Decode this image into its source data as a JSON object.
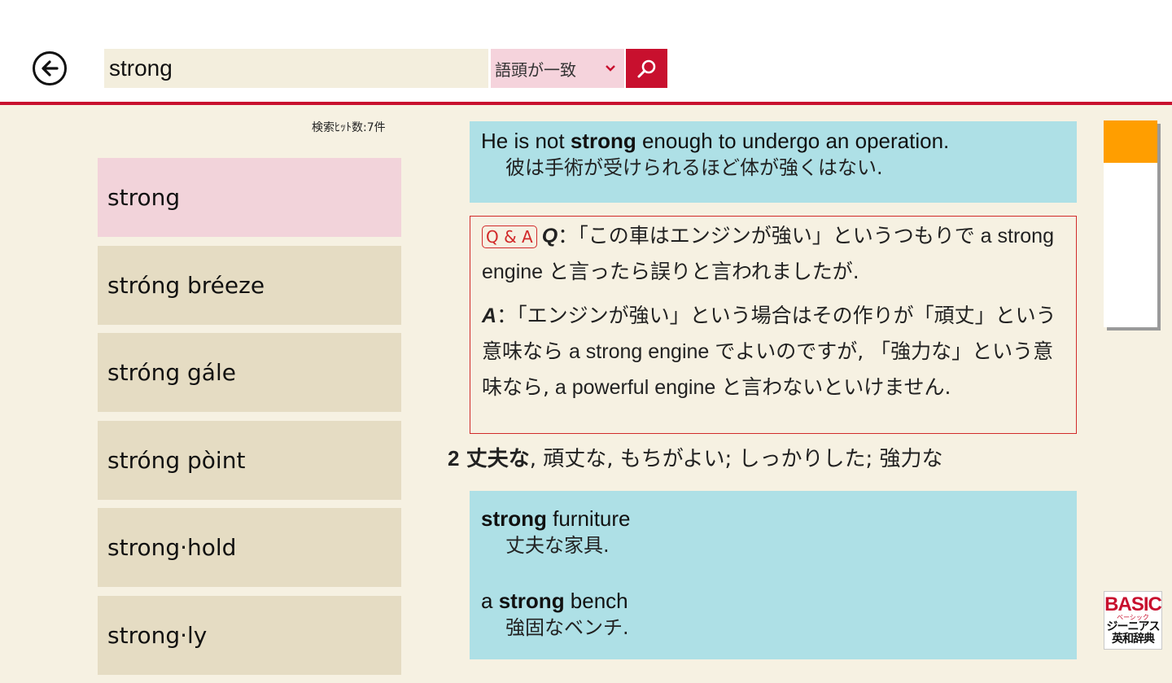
{
  "search": {
    "query": "strong",
    "mode_label": "語頭が一致"
  },
  "results": {
    "hit_count": "検索ﾋｯﾄ数:7件",
    "items": [
      {
        "label": "strong"
      },
      {
        "label": "stróng bréeze"
      },
      {
        "label": "stróng gále"
      },
      {
        "label": "stróng pòint"
      },
      {
        "label": "strong·hold"
      },
      {
        "label": "strong·ly"
      }
    ]
  },
  "entry": {
    "example1": {
      "en_before": "He is not ",
      "en_bold": "strong",
      "en_after": " enough to undergo an operation.",
      "ja": "彼は手術が受けられるほど体が強くはない."
    },
    "qa": {
      "badge": "Q & A",
      "q_label": "Q",
      "q_p1": "：「この車はエンジンが強い」というつもりで",
      "q_en1": " a strong engine ",
      "q_p2": "と言ったら誤りと言われましたが.",
      "a_label": "A",
      "a_p1": "：「エンジンが強い」という場合はその作りが「頑丈」という意味なら",
      "a_en1": " a strong engine ",
      "a_p2": "でよいのですが, 「強力な」という意味なら,",
      "a_en2": " a powerful engine ",
      "a_p3": "と言わないといけません."
    },
    "sense2": {
      "number": "2",
      "bold": "丈夫な",
      "rest": ", 頑丈な, もちがよい; しっかりした; 強力な"
    },
    "examples2": [
      {
        "en_before": "",
        "en_bold": "strong",
        "en_after": " furniture",
        "ja": "丈夫な家具."
      },
      {
        "en_before": "a ",
        "en_bold": "strong",
        "en_after": " bench",
        "ja": "強固なベンチ."
      }
    ]
  },
  "logo": {
    "line1": "BASIC",
    "line2": "ベーシック",
    "line3": "ジーニアス",
    "line4": "英和辞典"
  },
  "colors": {
    "accent": "#c8102e",
    "background": "#f6f1e2",
    "example_bg": "#aee0e6",
    "selected_item": "#f2d3da",
    "list_item": "#e5dcc3",
    "scroll_thumb": "#ff9e00"
  }
}
